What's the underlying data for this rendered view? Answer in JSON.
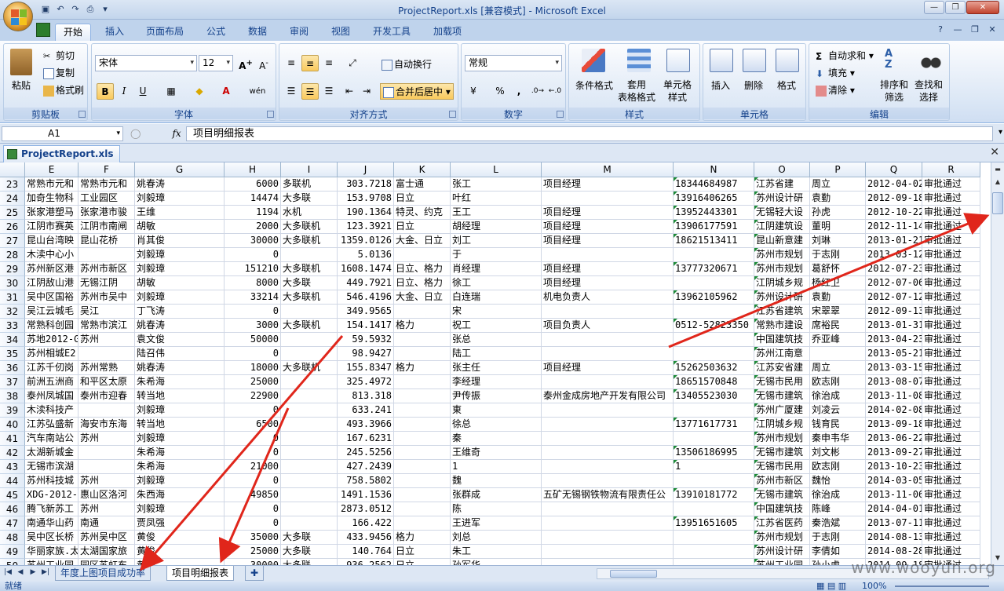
{
  "window": {
    "title": "ProjectReport.xls  [兼容模式] - Microsoft Excel",
    "controls": [
      "minimize-icon",
      "restore-icon",
      "close-icon"
    ]
  },
  "ribbon_tabs": [
    "开始",
    "插入",
    "页面布局",
    "公式",
    "数据",
    "审阅",
    "视图",
    "开发工具",
    "加载项"
  ],
  "active_tab": "开始",
  "clipboard": {
    "paste": "粘贴",
    "cut": "剪切",
    "copy": "复制",
    "format_painter": "格式刷",
    "group": "剪贴板"
  },
  "font": {
    "name": "宋体",
    "size": "12",
    "group": "字体",
    "bold": "B",
    "italic": "I",
    "underline": "U",
    "wen": "wén"
  },
  "alignment": {
    "wrap": "自动换行",
    "merge": "合并后居中",
    "group": "对齐方式"
  },
  "number": {
    "format": "常规",
    "percent": "%",
    "comma": ",",
    "group": "数字"
  },
  "styles": {
    "conditional": "条件格式",
    "table": "套用",
    "table2": "表格格式",
    "cell": "单元格",
    "cell2": "样式",
    "group": "样式"
  },
  "cells": {
    "insert": "插入",
    "delete": "删除",
    "format": "格式",
    "group": "单元格"
  },
  "editing": {
    "autosum": "自动求和",
    "fill": "填充",
    "clear": "清除",
    "sort": "排序和",
    "sort2": "筛选",
    "find": "查找和",
    "find2": "选择",
    "group": "编辑"
  },
  "formula_bar": {
    "name_box": "A1",
    "fx": "fx",
    "content": "项目明细报表"
  },
  "doc_tab": "ProjectReport.xls",
  "columns": [
    "E",
    "F",
    "G",
    "H",
    "I",
    "J",
    "K",
    "L",
    "M",
    "N",
    "O",
    "P",
    "Q",
    "R"
  ],
  "rows": [
    {
      "n": "23",
      "E": "常熟市元和",
      "F": "常熟市元和",
      "G": "姚春涛",
      "H": "6000",
      "I": "多联机",
      "J": "303.7218",
      "K": "富士通",
      "L": "张工",
      "M": "项目经理",
      "N": "18344684987",
      "O": "江苏省建",
      "P": "周立",
      "Q": "2012-04-02",
      "R": "审批通过"
    },
    {
      "n": "24",
      "E": "加奇生物科",
      "F": "工业园区",
      "G": "刘毅璋",
      "H": "14474",
      "I": "大多联",
      "J": "153.9708",
      "K": "日立",
      "L": "叶红",
      "M": "",
      "N": "13916406265",
      "O": "苏州设计研",
      "P": "袁勤",
      "Q": "2012-09-18",
      "R": "审批通过"
    },
    {
      "n": "25",
      "E": "张家港塑马",
      "F": "张家港市骏",
      "G": "王维",
      "H": "1194",
      "I": "水机",
      "J": "190.1364",
      "K": "特灵、约克",
      "L": "王工",
      "M": "项目经理",
      "N": "13952443301",
      "O": "无锡轻大设",
      "P": "孙虎",
      "Q": "2012-10-22",
      "R": "审批通过"
    },
    {
      "n": "26",
      "E": "江阴市赛英",
      "F": "江阴市南闸",
      "G": "胡敏",
      "H": "2000",
      "I": "大多联机",
      "J": "123.3921",
      "K": "日立",
      "L": "胡经理",
      "M": "项目经理",
      "N": "13906177591",
      "O": "江阴建筑设",
      "P": "董明",
      "Q": "2012-11-14",
      "R": "审批通过"
    },
    {
      "n": "27",
      "E": "昆山台湾映",
      "F": "昆山花桥",
      "G": "肖其俊",
      "H": "30000",
      "I": "大多联机",
      "J": "1359.0126",
      "K": "大金、日立",
      "L": "刘工",
      "M": "项目经理",
      "N": "18621513411",
      "O": "昆山新意建",
      "P": "刘琳",
      "Q": "2013-01-21",
      "R": "审批通过"
    },
    {
      "n": "28",
      "E": "木渎中心小",
      "F": "",
      "G": "刘毅璋",
      "H": "0",
      "I": "",
      "J": "5.0136",
      "K": "",
      "L": "于",
      "M": "",
      "N": "",
      "O": "苏州市规划",
      "P": "于志刚",
      "Q": "2013-03-12",
      "R": "审批通过"
    },
    {
      "n": "29",
      "E": "苏州新区港",
      "F": "苏州市新区",
      "G": "刘毅璋",
      "H": "151210",
      "I": "大多联机",
      "J": "1608.1474",
      "K": "日立、格力",
      "L": "肖经理",
      "M": "项目经理",
      "N": "13777320671",
      "O": "苏州市规划",
      "P": "葛舒怀",
      "Q": "2012-07-23",
      "R": "审批通过"
    },
    {
      "n": "30",
      "E": "江阴敌山港",
      "F": "无锡江阴",
      "G": "胡敏",
      "H": "8000",
      "I": "大多联",
      "J": "449.7921",
      "K": "日立、格力",
      "L": "徐工",
      "M": "项目经理",
      "N": "",
      "O": "江阴城乡规",
      "P": "杨红卫",
      "Q": "2012-07-06",
      "R": "审批通过"
    },
    {
      "n": "31",
      "E": "吴中区国裕",
      "F": "苏州市吴中",
      "G": "刘毅璋",
      "H": "33214",
      "I": "大多联机",
      "J": "546.4196",
      "K": "大金、日立",
      "L": "白连瑞",
      "M": "机电负责人",
      "N": "13962105962",
      "O": "苏州设计研",
      "P": "袁勤",
      "Q": "2012-07-12",
      "R": "审批通过"
    },
    {
      "n": "32",
      "E": "吴江云城毛",
      "F": "吴江",
      "G": "丁飞涛",
      "H": "0",
      "I": "",
      "J": "349.9565",
      "K": "",
      "L": "宋",
      "M": "",
      "N": "",
      "O": "江苏省建筑",
      "P": "宋翠翠",
      "Q": "2012-09-13",
      "R": "审批通过"
    },
    {
      "n": "33",
      "E": "常熟科创园",
      "F": "常熟市滨江",
      "G": "姚春涛",
      "H": "3000",
      "I": "大多联机",
      "J": "154.1417",
      "K": "格力",
      "L": "祝工",
      "M": "项目负责人",
      "N": "0512-52823350",
      "O": "常熟市建设",
      "P": "席裕民",
      "Q": "2013-01-31",
      "R": "审批通过"
    },
    {
      "n": "34",
      "E": "苏地2012-G",
      "F": "苏州",
      "G": "袁文俊",
      "H": "50000",
      "I": "",
      "J": "59.5932",
      "K": "",
      "L": "张总",
      "M": "",
      "N": "",
      "O": "中国建筑技",
      "P": "乔亚峰",
      "Q": "2013-04-23",
      "R": "审批通过"
    },
    {
      "n": "35",
      "E": "苏州相城E2",
      "F": "",
      "G": "陆召伟",
      "H": "0",
      "I": "",
      "J": "98.9427",
      "K": "",
      "L": "陆工",
      "M": "",
      "N": "",
      "O": "苏州江南意",
      "P": "",
      "Q": "2013-05-21",
      "R": "审批通过"
    },
    {
      "n": "36",
      "E": "江苏千仞岗",
      "F": "苏州常熟",
      "G": "姚春涛",
      "H": "18000",
      "I": "大多联机",
      "J": "155.8347",
      "K": "格力",
      "L": "张主任",
      "M": "项目经理",
      "N": "15262503632",
      "O": "江苏安省建",
      "P": "周立",
      "Q": "2013-03-15",
      "R": "审批通过"
    },
    {
      "n": "37",
      "E": "前洲五洲商",
      "F": "和平区太原",
      "G": "朱希海",
      "H": "25000",
      "I": "",
      "J": "325.4972",
      "K": "",
      "L": "李经理",
      "M": "",
      "N": "18651570848",
      "O": "无锡市民用",
      "P": "欧志刚",
      "Q": "2013-08-07",
      "R": "审批通过"
    },
    {
      "n": "38",
      "E": "泰州凤城国",
      "F": "泰州市迎春",
      "G": "转当地",
      "H": "22900",
      "I": "",
      "J": "813.318",
      "K": "",
      "L": "尹传振",
      "M": "泰州金成房地产开发有限公司",
      "N": "13405523030",
      "O": "无锡市建筑",
      "P": "徐治成",
      "Q": "2013-11-08",
      "R": "审批通过"
    },
    {
      "n": "39",
      "E": "木渎科技产",
      "F": "",
      "G": "刘毅璋",
      "H": "0",
      "I": "",
      "J": "633.241",
      "K": "",
      "L": "東",
      "M": "",
      "N": "",
      "O": "苏州广厦建",
      "P": "刘凌云",
      "Q": "2014-02-08",
      "R": "审批通过"
    },
    {
      "n": "40",
      "E": "江苏弘盛新",
      "F": "海安市东海",
      "G": "转当地",
      "H": "6500",
      "I": "",
      "J": "493.3966",
      "K": "",
      "L": "徐总",
      "M": "",
      "N": "13771617731",
      "O": "江阴城乡规",
      "P": "钱育民",
      "Q": "2013-09-18",
      "R": "审批通过"
    },
    {
      "n": "41",
      "E": "汽车南站公",
      "F": "苏州",
      "G": "刘毅璋",
      "H": "0",
      "I": "",
      "J": "167.6231",
      "K": "",
      "L": "秦",
      "M": "",
      "N": "",
      "O": "苏州市规划",
      "P": "秦申韦华",
      "Q": "2013-06-22",
      "R": "审批通过"
    },
    {
      "n": "42",
      "E": "太湖新城金",
      "F": "",
      "G": "朱希海",
      "H": "0",
      "I": "",
      "J": "245.5256",
      "K": "",
      "L": "王维奇",
      "M": "",
      "N": "13506186995",
      "O": "无锡市建筑",
      "P": "刘文彬",
      "Q": "2013-09-27",
      "R": "审批通过"
    },
    {
      "n": "43",
      "E": "无锡市滨湖",
      "F": "",
      "G": "朱希海",
      "H": "21000",
      "I": "",
      "J": "427.2439",
      "K": "",
      "L": "1",
      "M": "",
      "N": "1",
      "O": "无锡市民用",
      "P": "欧志刚",
      "Q": "2013-10-23",
      "R": "审批通过"
    },
    {
      "n": "44",
      "E": "苏州科技城",
      "F": "苏州",
      "G": "刘毅璋",
      "H": "0",
      "I": "",
      "J": "758.5802",
      "K": "",
      "L": "魏",
      "M": "",
      "N": "",
      "O": "苏州市新区",
      "P": "魏怡",
      "Q": "2014-03-05",
      "R": "审批通过"
    },
    {
      "n": "45",
      "E": "XDG-2012-8",
      "F": "惠山区洛河",
      "G": "朱西海",
      "H": "49850",
      "I": "",
      "J": "1491.1536",
      "K": "",
      "L": "张群成",
      "M": "五矿无锡钢铁物流有限责任公",
      "N": "13910181772",
      "O": "无锡市建筑",
      "P": "徐治成",
      "Q": "2013-11-06",
      "R": "审批通过"
    },
    {
      "n": "46",
      "E": "腾飞新苏工",
      "F": "苏州",
      "G": "刘毅璋",
      "H": "0",
      "I": "",
      "J": "2873.0512",
      "K": "",
      "L": "陈",
      "M": "",
      "N": "",
      "O": "中国建筑技",
      "P": "陈峰",
      "Q": "2014-04-01",
      "R": "审批通过"
    },
    {
      "n": "47",
      "E": "南通华山药",
      "F": "南通",
      "G": "贾凤强",
      "H": "0",
      "I": "",
      "J": "166.422",
      "K": "",
      "L": "王进军",
      "M": "",
      "N": "13951651605",
      "O": "江苏省医药",
      "P": "秦浩斌",
      "Q": "2013-07-11",
      "R": "审批通过"
    },
    {
      "n": "48",
      "E": "吴中区长桥",
      "F": "苏州吴中区",
      "G": "黄俊",
      "H": "35000",
      "I": "大多联",
      "J": "433.9456",
      "K": "格力",
      "L": "刘总",
      "M": "",
      "N": "",
      "O": "苏州市规划",
      "P": "于志刚",
      "Q": "2014-08-13",
      "R": "审批通过"
    },
    {
      "n": "49",
      "E": "华丽家族.太",
      "F": "太湖国家旅",
      "G": "黄俊",
      "H": "25000",
      "I": "大多联",
      "J": "140.764",
      "K": "日立",
      "L": "朱工",
      "M": "",
      "N": "",
      "O": "苏州设计研",
      "P": "李倩如",
      "Q": "2014-08-28",
      "R": "审批通过"
    },
    {
      "n": "50",
      "E": "苏州工业园",
      "F": "园区苏虹东",
      "G": "黄俊",
      "H": "30000",
      "I": "大多联",
      "J": "936.2562",
      "K": "日立",
      "L": "孙军华",
      "M": "",
      "N": "",
      "O": "苏州工业园",
      "P": "孙小虎",
      "Q": "2014-09-18",
      "R": "审批通过"
    }
  ],
  "sheet_tabs": [
    "年度上图项目成功率",
    "项目明细报表"
  ],
  "active_sheet": "项目明细报表",
  "status": {
    "ready": "就绪",
    "zoom": "100%"
  },
  "watermark": "www.wooyun.org",
  "colors": {
    "annotation_arrow": "#e0261b",
    "tab_bar": "#bfd3ec",
    "header_fill": "#e1ebf7"
  }
}
